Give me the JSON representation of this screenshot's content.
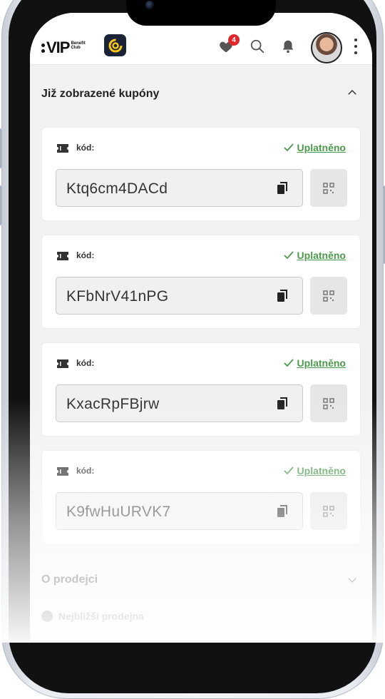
{
  "header": {
    "logo_text": "VIP",
    "logo_sub_line1": "Benefit",
    "logo_sub_line2": "Club",
    "notification_count": "4"
  },
  "section": {
    "title": "Již zobrazené kupóny"
  },
  "coupons": [
    {
      "label": "kód:",
      "status": "Uplatněno",
      "code": "Ktq6cm4DACd"
    },
    {
      "label": "kód:",
      "status": "Uplatněno",
      "code": "KFbNrV41nPG"
    },
    {
      "label": "kód:",
      "status": "Uplatněno",
      "code": "KxacRpFBjrw"
    },
    {
      "label": "kód:",
      "status": "Uplatněno",
      "code": "K9fwHuURVK7"
    }
  ],
  "about": {
    "title": "O prodejci",
    "next_label": "Nejbližší prodejna"
  },
  "colors": {
    "accent_green": "#4a9a4a",
    "badge_red": "#e3262b",
    "app_icon_bg": "#1b2437",
    "app_icon_ring": "#f5c518"
  }
}
